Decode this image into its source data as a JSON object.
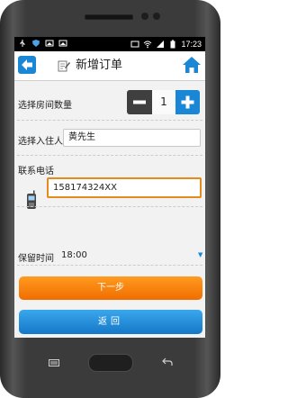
{
  "status_bar": {
    "time": "17:23",
    "icons_left": [
      "usb-icon",
      "shield-icon",
      "image-icon",
      "image-icon"
    ],
    "icons_right": [
      "image-icon",
      "wifi-signal-icon",
      "cell-signal-icon",
      "battery-icon"
    ]
  },
  "header": {
    "title": "新增订单",
    "back_icon": "back-arrow-icon",
    "title_icon": "edit-note-icon",
    "home_icon": "home-icon"
  },
  "form": {
    "room_count": {
      "label": "选择房间数量",
      "value": "1"
    },
    "guest": {
      "label": "选择入住人",
      "value": "黄先生"
    },
    "phone": {
      "label": "联系电话",
      "value": "158174324XX"
    },
    "hold_time": {
      "label": "保留时间",
      "value": "18:00"
    }
  },
  "buttons": {
    "next": "下一步",
    "return": "返回"
  },
  "colors": {
    "accent_blue": "#1a86d6",
    "orange": "#f07f10",
    "focus_border": "#e58b1c"
  }
}
